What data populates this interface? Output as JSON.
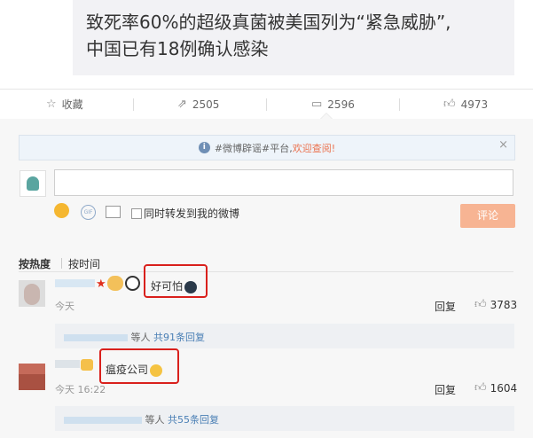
{
  "article": {
    "title_line1": "致死率60%的超级真菌被美国列为“紧急威胁”,",
    "title_line2": "中国已有18例确认感染"
  },
  "actions": {
    "favorite_label": "收藏",
    "repost_count": "2505",
    "comment_count": "2596",
    "like_count": "4973"
  },
  "notice": {
    "prefix": "#微博辟谣#平台,",
    "link_text": "欢迎查阅!",
    "close": "×"
  },
  "composer": {
    "gif_label": "GIF",
    "repost_checkbox_label": "同时转发到我的微博",
    "submit_label": "评论"
  },
  "sort": {
    "by_hot": "按热度",
    "by_time": "按时间"
  },
  "comments": [
    {
      "text": "好可怕",
      "time": "今天",
      "reply_label": "回复",
      "likes": "3783",
      "sub_replies": {
        "suffix": "等人",
        "count_text": "共91条回复"
      }
    },
    {
      "text": "瘟疫公司",
      "time": "今天 16:22",
      "reply_label": "回复",
      "likes": "1604",
      "sub_replies": {
        "suffix": "等人",
        "count_text": "共55条回复"
      }
    }
  ],
  "icons": {
    "favorite": "star-outline-icon",
    "repost": "share-arrow-icon",
    "comment": "comment-bubble-icon",
    "like": "thumb-up-icon"
  },
  "colors": {
    "accent": "#eb7350",
    "highlight_box": "#d9201c",
    "link_blue": "#4a7fb5",
    "submit_bg": "#f7b493"
  }
}
